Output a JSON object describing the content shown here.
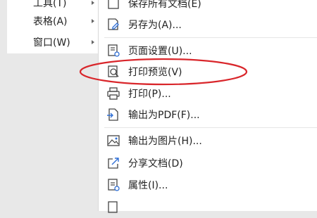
{
  "left_menu": {
    "items": [
      {
        "label": "工具(T)"
      },
      {
        "label": "表格(A)"
      },
      {
        "label": "窗口(W)"
      }
    ]
  },
  "file_menu": {
    "items": [
      {
        "label": "保存所有文档(E)",
        "icon": "save-all-icon"
      },
      {
        "label": "另存为(A)...",
        "icon": "save-as-icon"
      },
      {
        "label": "页面设置(U)...",
        "icon": "page-setup-icon"
      },
      {
        "label": "打印预览(V)",
        "icon": "print-preview-icon"
      },
      {
        "label": "打印(P)...",
        "icon": "printer-icon"
      },
      {
        "label": "输出为PDF(F)...",
        "icon": "export-pdf-icon"
      },
      {
        "label": "输出为图片(H)...",
        "icon": "export-image-icon"
      },
      {
        "label": "分享文档(D)",
        "icon": "share-icon"
      },
      {
        "label": "属性(I)...",
        "icon": "properties-icon"
      },
      {
        "label": "",
        "icon": "doc-icon"
      }
    ]
  },
  "annotation": {
    "color": "#d9262b"
  }
}
